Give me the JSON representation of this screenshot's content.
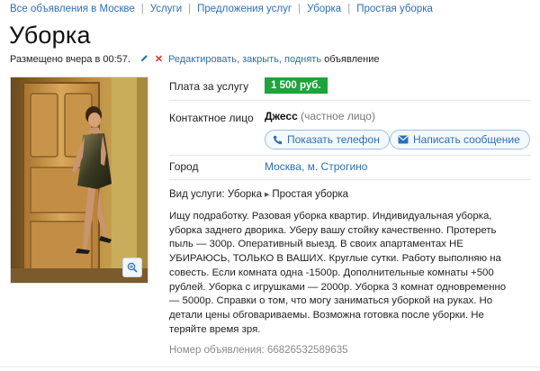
{
  "breadcrumb": [
    {
      "label": "Все объявления в Москве"
    },
    {
      "label": "Услуги"
    },
    {
      "label": "Предложения услуг"
    },
    {
      "label": "Уборка"
    },
    {
      "label": "Простая уборка"
    }
  ],
  "listing": {
    "title": "Уборка",
    "posted": "Размещено вчера в 00:57.",
    "manage_link": "Редактировать, закрыть, поднять",
    "manage_suffix": "объявление"
  },
  "details": {
    "price_label": "Плата за услугу",
    "price_value": "1 500 руб.",
    "contact_label": "Контактное лицо",
    "contact_name": "Джесс",
    "contact_type": "(частное лицо)",
    "show_phone_button": "Показать телефон",
    "write_message_button": "Написать сообщение",
    "city_label": "Город",
    "city_value": "Москва, м. Строгино"
  },
  "service": {
    "label": "Вид услуги:",
    "category": "Уборка",
    "subcategory": "Простая уборка"
  },
  "description": "Ищу подработку. Разовая уборка квартир. Индивидуальная уборка, уборка заднего дворика. Уберу вашу стойку качественно. Протереть пыль — 300р. Оперативный выезд. В своих апартаментах НЕ УБИРАЮСЬ, ТОЛЬКО В ВАШИХ. Круглые сутки. Работу выполняю на совесть. Если комната одна -1500р. Дополнительные комнаты +500 рублей. Уборка с игрушками — 2000р. Уборка 3 комнат одновременно — 5000р. Справки о том, что могу заниматься уборкой на руках. Но детали цены обговариваемы. Возможна готовка после уборки. Не теряйте время зря.",
  "ad_number": "Номер объявления: 66826532589635",
  "icons": {
    "edit": "pencil-icon",
    "delete": "close-icon",
    "phone": "phone-icon",
    "message": "envelope-icon",
    "zoom": "zoom-in-icon",
    "breadcrumb_separator": "slash-separator",
    "service_arrow": "triangle-right-icon"
  },
  "colors": {
    "link": "#2d6fb6",
    "price_badge": "#1fa33a",
    "delete_icon": "#d9312b"
  }
}
